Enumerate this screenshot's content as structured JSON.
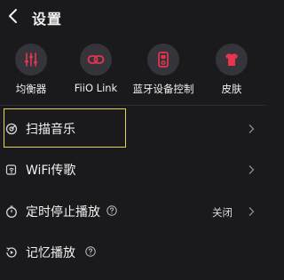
{
  "header": {
    "title": "设置",
    "back_icon": "back-arrow-icon"
  },
  "shortcuts": [
    {
      "label": "均衡器",
      "icon": "equalizer-icon"
    },
    {
      "label": "FiiO Link",
      "icon": "link-icon"
    },
    {
      "label": "蓝牙设备控制",
      "icon": "bluetooth-device-icon"
    },
    {
      "label": "皮肤",
      "icon": "shirt-icon"
    }
  ],
  "rows": [
    {
      "label": "扫描音乐",
      "icon": "scan-music-icon",
      "value": "",
      "highlighted": true
    },
    {
      "label": "WiFi传歌",
      "icon": "wifi-transfer-icon",
      "value": ""
    },
    {
      "label": "定时停止播放",
      "icon": "timer-icon",
      "value": "关闭",
      "help_icon": "help-icon"
    },
    {
      "label": "记忆播放",
      "icon": "memory-play-icon",
      "value": ""
    }
  ],
  "colors": {
    "background": "#1a1a1c",
    "accent": "#e8344e",
    "icon_circle": "#34343a",
    "highlight_border": "#e3d65a"
  }
}
